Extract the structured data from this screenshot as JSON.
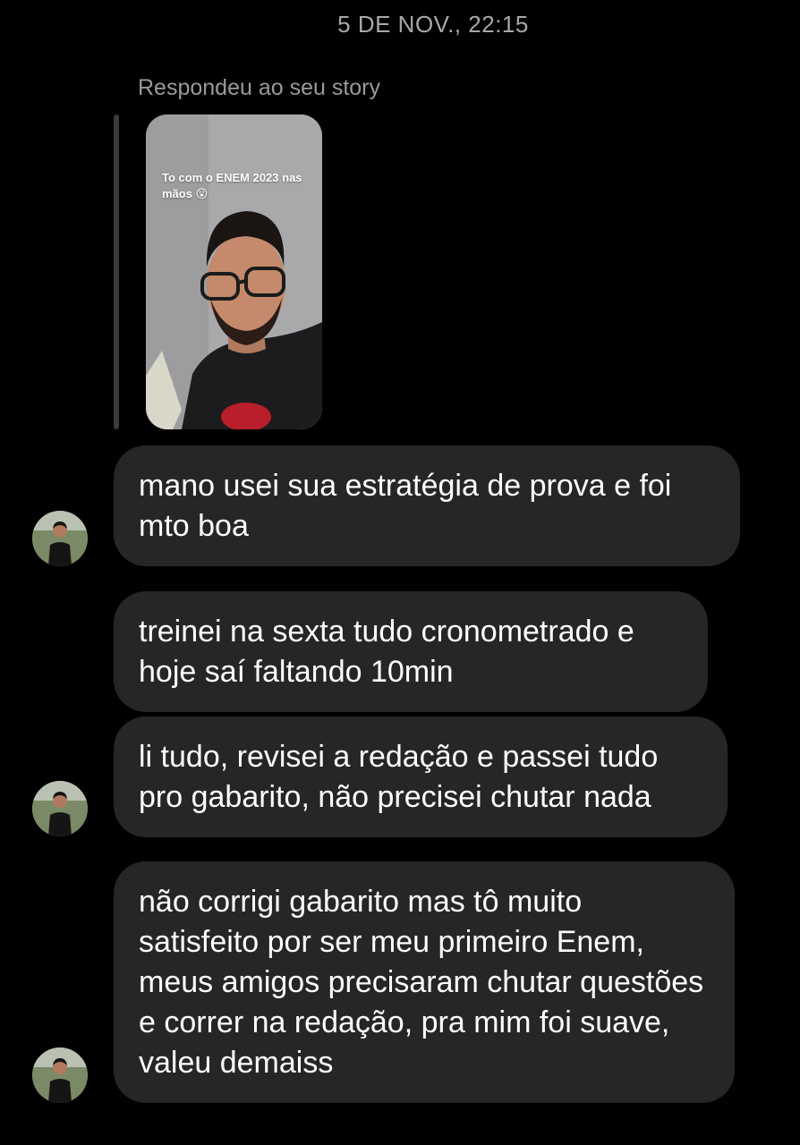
{
  "conversation": {
    "timestamp": "5 DE NOV., 22:15",
    "reply_label": "Respondeu ao seu story",
    "story": {
      "caption": "To com o ENEM 2023 nas mãos 😮"
    },
    "messages": [
      {
        "text": "mano usei sua estratégia de prova e foi mto boa"
      },
      {
        "text": "treinei na sexta tudo cronometrado e hoje saí faltando 10min"
      },
      {
        "text": "li tudo, revisei a redação e passei tudo pro gabarito, não precisei chutar nada"
      },
      {
        "text": "não corrigi gabarito mas tô muito satisfeito por ser meu primeiro Enem, meus amigos precisaram chutar questões e correr na redação, pra mim foi suave, valeu demaiss"
      }
    ]
  },
  "colors": {
    "background": "#000000",
    "bubble": "#262626",
    "timestamp_text": "#a8a8a8"
  }
}
